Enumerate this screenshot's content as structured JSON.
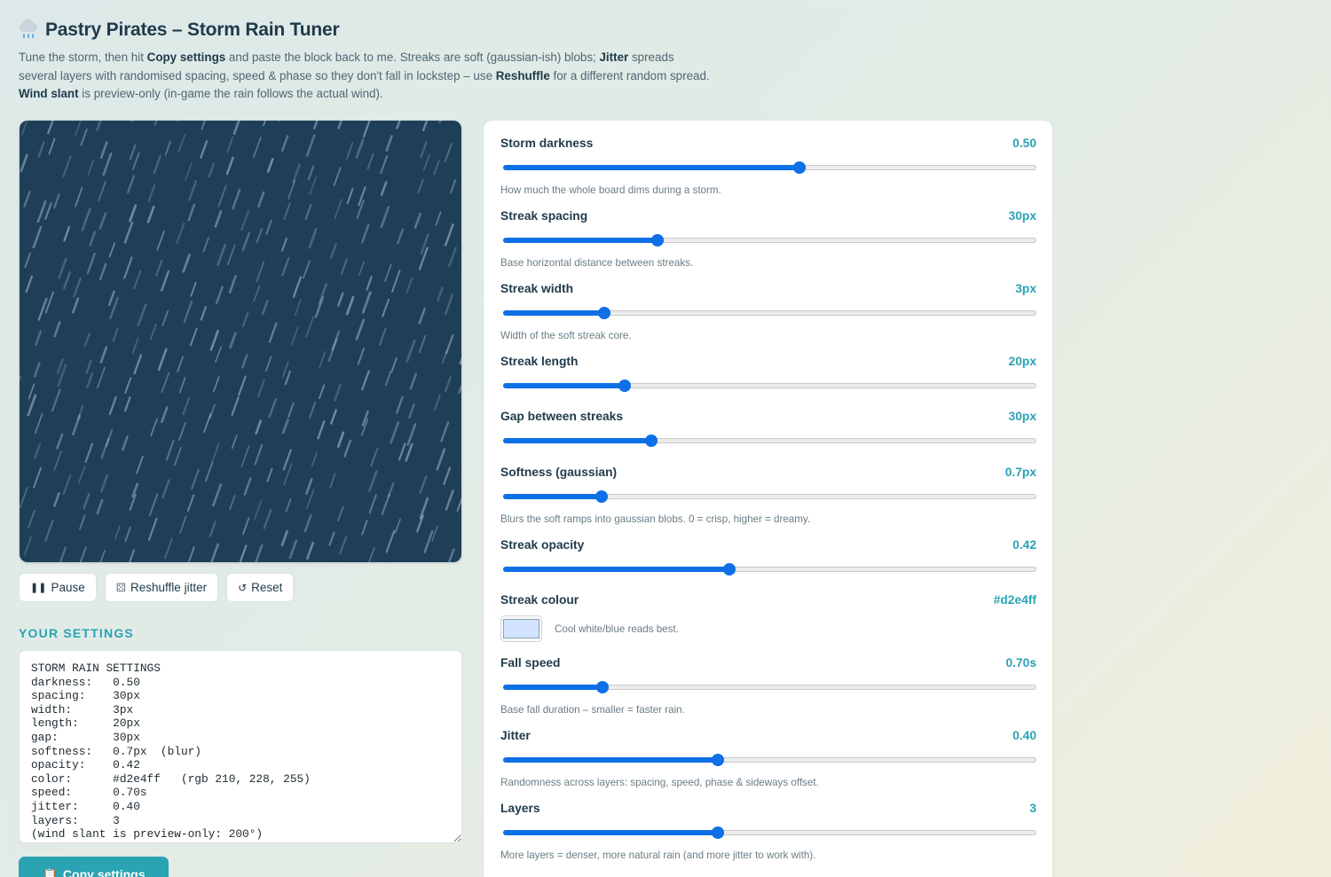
{
  "header": {
    "title": "Pastry Pirates – Storm Rain Tuner",
    "intro_1": "Tune the storm, then hit ",
    "intro_copy": "Copy settings",
    "intro_2": " and paste the block back to me. Streaks are soft (gaussian-ish) blobs; ",
    "intro_jitter": "Jitter",
    "intro_3": " spreads several layers with randomised spacing, speed & phase so they don't fall in lockstep – use ",
    "intro_reshuffle": "Reshuffle",
    "intro_4": " for a different random spread. ",
    "intro_wind": "Wind slant",
    "intro_5": " is preview-only (in-game the rain follows the actual wind)."
  },
  "buttons": {
    "pause": "Pause",
    "pause_icon": "pause-icon",
    "reshuffle": "Reshuffle jitter",
    "reshuffle_icon": "dice-icon",
    "reset": "Reset",
    "reset_icon": "reset-icon",
    "copy": "Copy settings",
    "copy_icon": "clipboard-icon"
  },
  "settings": {
    "heading": "YOUR SETTINGS",
    "text": "STORM RAIN SETTINGS\ndarkness:   0.50\nspacing:    30px\nwidth:      3px\nlength:     20px\ngap:        30px\nsoftness:   0.7px  (blur)\nopacity:    0.42\ncolor:      #d2e4ff   (rgb 210, 228, 255)\nspeed:      0.70s\njitter:     0.40\nlayers:     3\n(wind slant is preview-only: 200°)"
  },
  "controls": {
    "darkness": {
      "label": "Storm darkness",
      "value": "0.50",
      "fraction": 0.556,
      "hint": "How much the whole board dims during a storm."
    },
    "spacing": {
      "label": "Streak spacing",
      "value": "30px",
      "fraction": 0.29,
      "hint": "Base horizontal distance between streaks."
    },
    "width": {
      "label": "Streak width",
      "value": "3px",
      "fraction": 0.19,
      "hint": "Width of the soft streak core."
    },
    "length": {
      "label": "Streak length",
      "value": "20px",
      "fraction": 0.228,
      "hint": ""
    },
    "gap": {
      "label": "Gap between streaks",
      "value": "30px",
      "fraction": 0.278,
      "hint": ""
    },
    "softness": {
      "label": "Softness (gaussian)",
      "value": "0.7px",
      "fraction": 0.184,
      "hint": "Blurs the soft ramps into gaussian blobs. 0 = crisp, higher = dreamy."
    },
    "opacity": {
      "label": "Streak opacity",
      "value": "0.42",
      "fraction": 0.424,
      "hint": ""
    },
    "colour": {
      "label": "Streak colour",
      "value": "#d2e4ff",
      "hint": "Cool white/blue reads best."
    },
    "speed": {
      "label": "Fall speed",
      "value": "0.70s",
      "fraction": 0.186,
      "hint": "Base fall duration – smaller = faster rain."
    },
    "jitter": {
      "label": "Jitter",
      "value": "0.40",
      "fraction": 0.403,
      "hint": "Randomness across layers: spacing, speed, phase & sideways offset."
    },
    "layers": {
      "label": "Layers",
      "value": "3",
      "fraction": 0.403,
      "hint": "More layers = denser, more natural rain (and more jitter to work with)."
    }
  },
  "colors": {
    "accent": "#2aa3b3",
    "slider": "#0f6fe6",
    "preview_bg": "#1f3f58",
    "streak": "#d2e4ff"
  }
}
